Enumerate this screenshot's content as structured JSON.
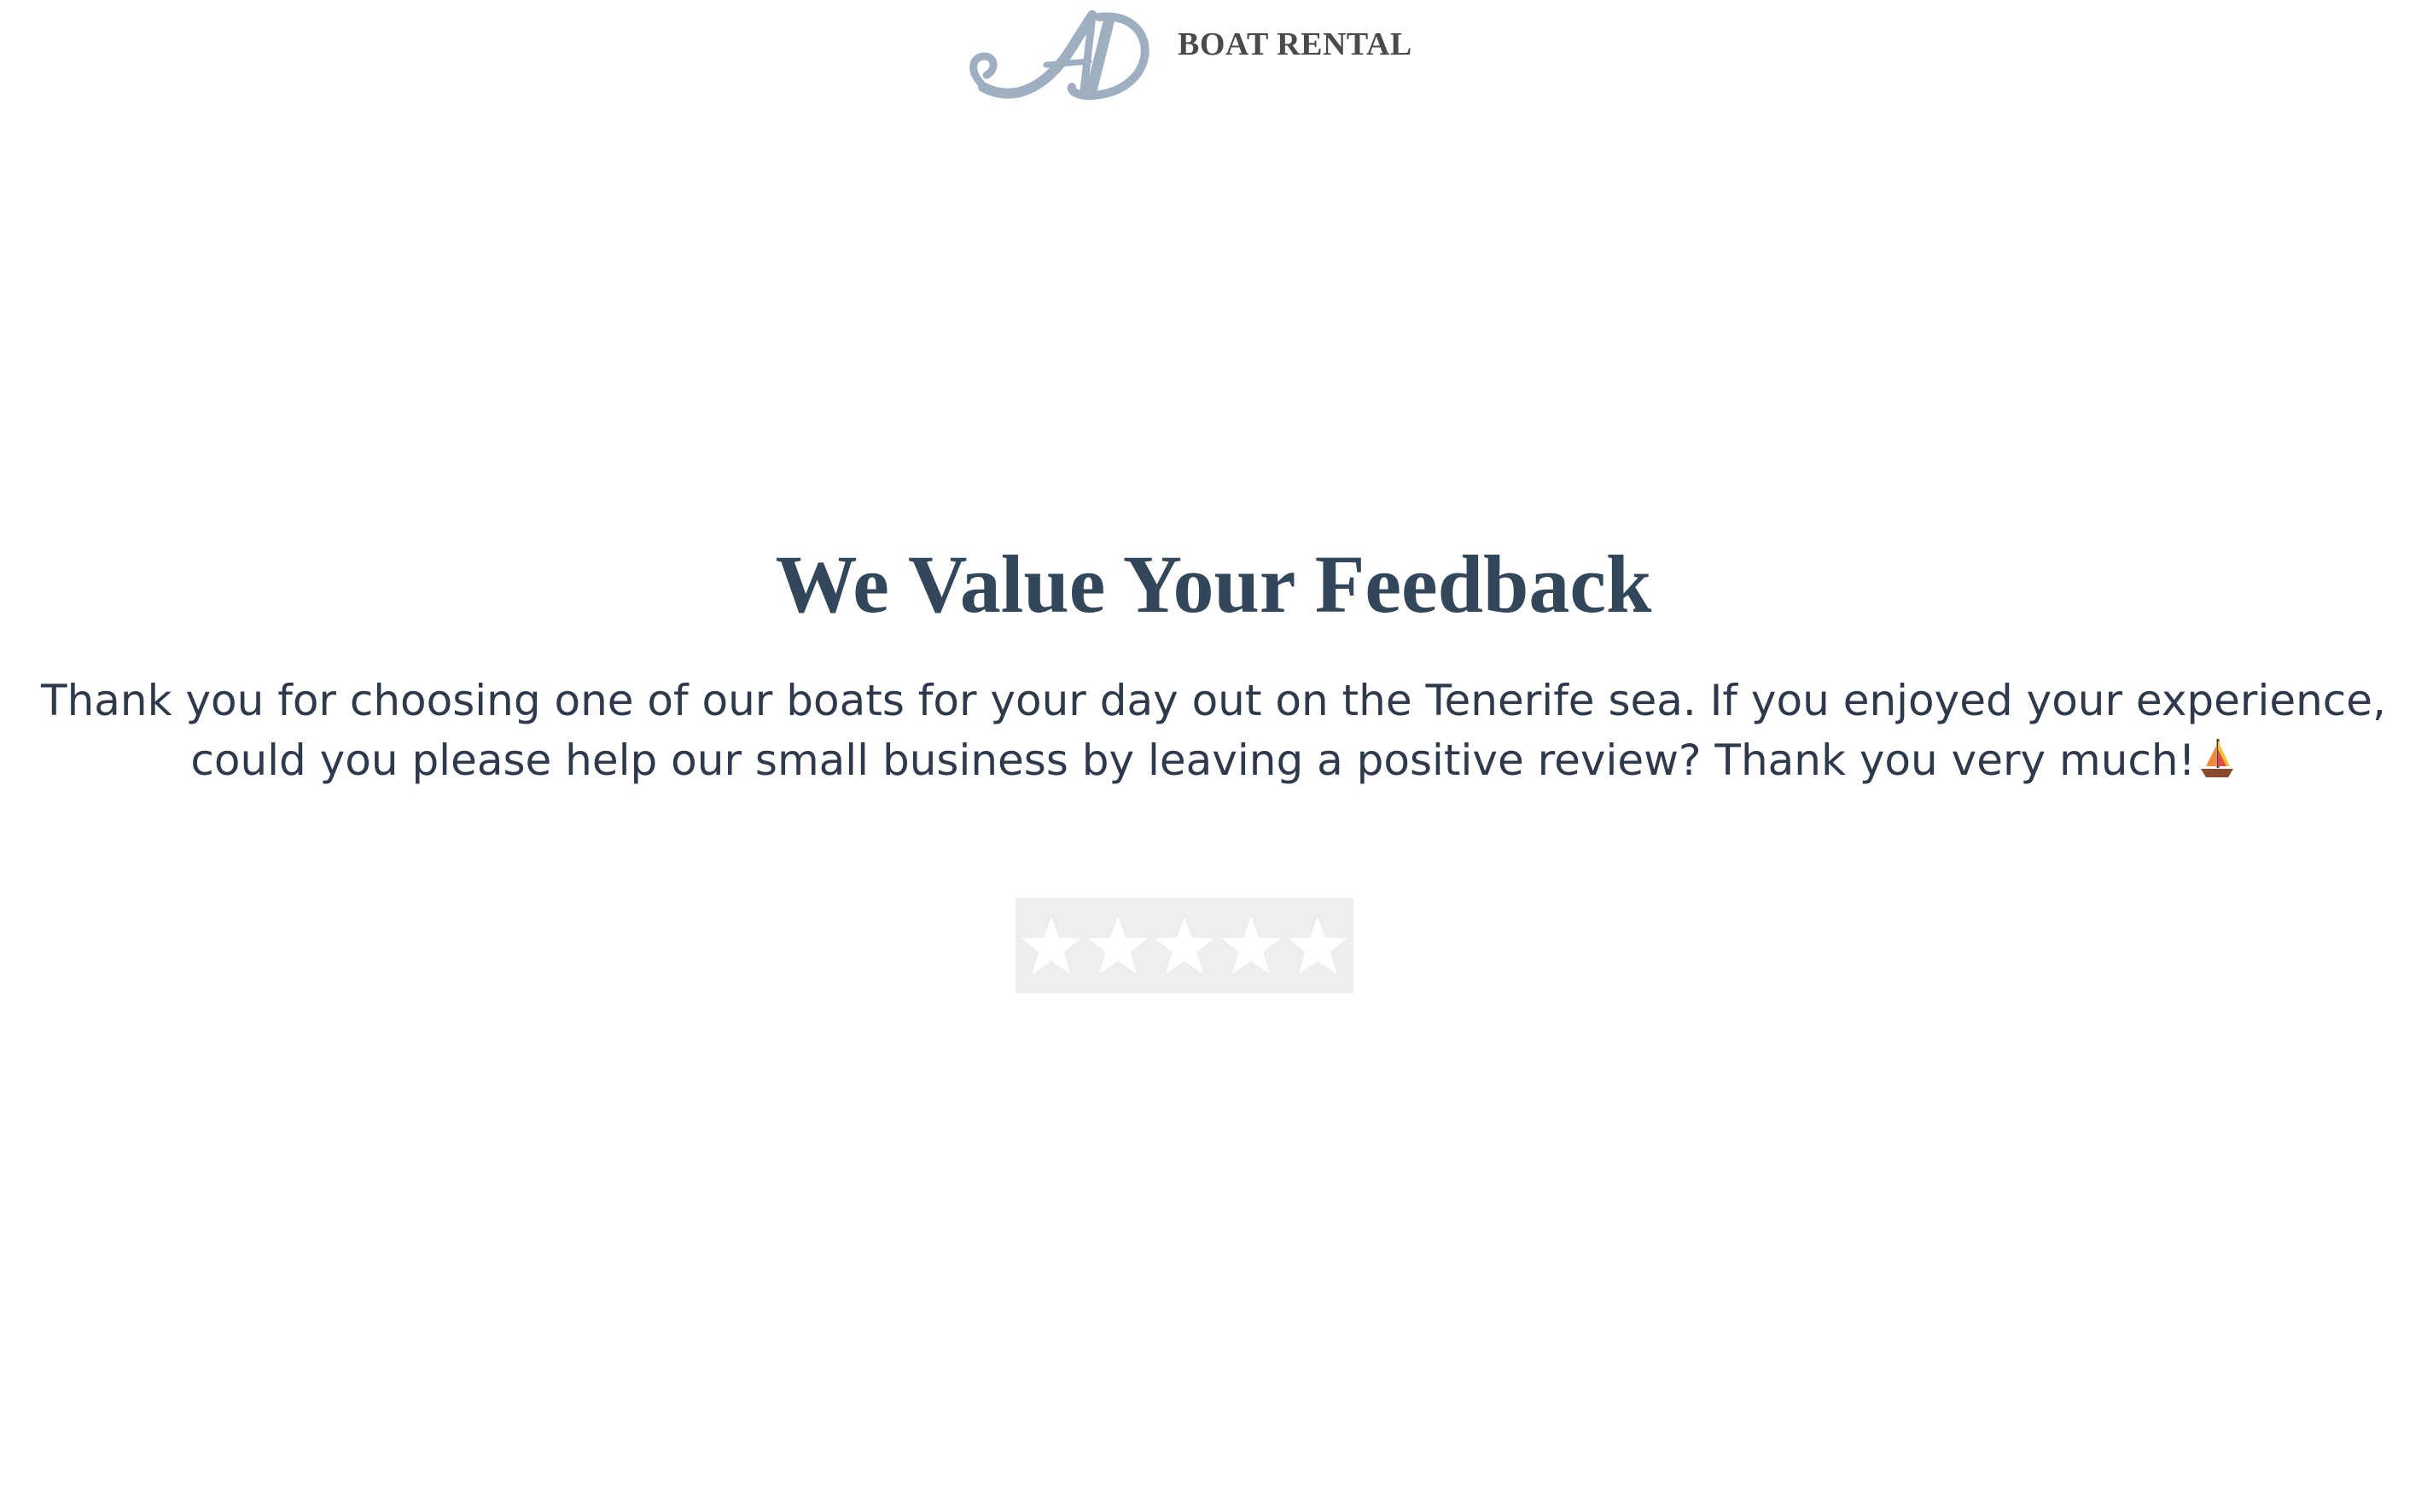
{
  "header": {
    "logo_monogram": "AD",
    "brand_text": "BOAT RENTAL",
    "logo_color": "#9eafc2"
  },
  "main": {
    "title": "We Value Your Feedback",
    "message_line_1": "Thank you for choosing one of our boats for your day out on the Tenerife sea. If you enjoyed your experience,",
    "message_line_2": "could you please help our small business by leaving a positive review? Thank you very much!",
    "message_emoji_icon": "sailboat-icon"
  },
  "rating": {
    "max_stars": 5,
    "selected_stars": 0,
    "star_icon": "star-icon",
    "background_color": "#eeeeee",
    "star_color": "#ffffff"
  },
  "colors": {
    "title": "#33475b",
    "body_text": "#2e3a4c",
    "brand_text": "#4a4a4a"
  }
}
